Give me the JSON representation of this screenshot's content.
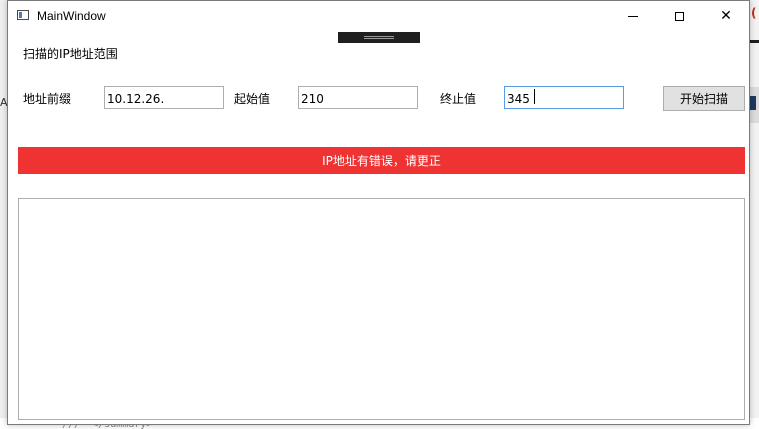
{
  "window": {
    "title": "MainWindow",
    "icon": "app-window-icon",
    "controls": {
      "minimize": "minimize-icon",
      "maximize": "maximize-icon",
      "close_glyph": "✕"
    }
  },
  "form": {
    "section_label": "扫描的IP地址范围",
    "prefix_label": "地址前缀",
    "prefix_value": "10.12.26.",
    "start_label": "起始值",
    "start_value": "210",
    "end_label": "终止值",
    "end_value": "345",
    "scan_button_label": "开始扫描"
  },
  "status": {
    "error_message": "IP地址有错误，请更正",
    "error_color": "#ef3333"
  },
  "output": {
    "value": ""
  },
  "background": {
    "left_edge_char": "A",
    "right_edge_char": "(",
    "code_line": "///  </summary>"
  }
}
